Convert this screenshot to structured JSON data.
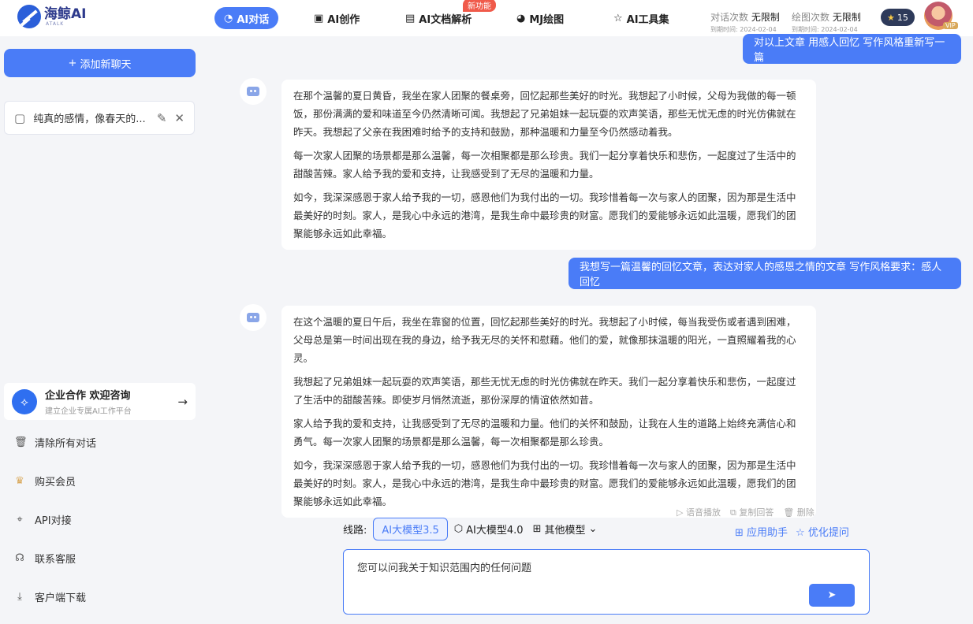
{
  "brand": {
    "name": "海鲸AI",
    "sub": "ATALK"
  },
  "nav": [
    {
      "label": "AI对话",
      "icon": "chat-icon"
    },
    {
      "label": "AI创作",
      "icon": "create-icon"
    },
    {
      "label": "AI文档解析",
      "icon": "pdf-icon",
      "badge": "新功能"
    },
    {
      "label": "MJ绘图",
      "icon": "palette-icon"
    },
    {
      "label": "AI工具集",
      "icon": "star-icon"
    }
  ],
  "quota": {
    "chat_label": "对话次数",
    "chat_value": "无限制",
    "chat_expire": "到期时间: 2024-02-04",
    "draw_label": "绘图次数",
    "draw_value": "无限制",
    "draw_expire": "到期时间: 2024-02-04"
  },
  "user": {
    "points": "15",
    "vip": "VIP"
  },
  "sidebar": {
    "new_chat": "添加新聊天",
    "chat_item": "纯真的感情，像春天的...",
    "enterprise": {
      "title": "企业合作 欢迎咨询",
      "sub": "建立企业专属AI工作平台"
    },
    "links": [
      "清除所有对话",
      "购买会员",
      "API对接",
      "联系客服",
      "客户端下载"
    ]
  },
  "messages": {
    "user1": "对以上文章 用感人回忆 写作风格重新写一篇",
    "bot1": [
      "在那个温馨的夏日黄昏，我坐在家人团聚的餐桌旁，回忆起那些美好的时光。我想起了小时候，父母为我做的每一顿饭，那份满满的爱和味道至今仍然清晰可闻。我想起了兄弟姐妹一起玩耍的欢声笑语，那些无忧无虑的时光仿佛就在昨天。我想起了父亲在我困难时给予的支持和鼓励，那种温暖和力量至今仍然感动着我。",
      "每一次家人团聚的场景都是那么温馨，每一次相聚都是那么珍贵。我们一起分享着快乐和悲伤，一起度过了生活中的甜酸苦辣。家人给予我的爱和支持，让我感受到了无尽的温暖和力量。",
      "如今，我深深感恩于家人给予我的一切，感恩他们为我付出的一切。我珍惜着每一次与家人的团聚，因为那是生活中最美好的时刻。家人，是我心中永远的港湾，是我生命中最珍贵的财富。愿我们的爱能够永远如此温暖，愿我们的团聚能够永远如此幸福。"
    ],
    "user2": "我想写一篇温馨的回忆文章，表达对家人的感恩之情的文章 写作风格要求：感人回忆",
    "bot2": [
      "在这个温暖的夏日午后，我坐在靠窗的位置，回忆起那些美好的时光。我想起了小时候，每当我受伤或者遇到困难，父母总是第一时间出现在我的身边，给予我无尽的关怀和慰藉。他们的爱，就像那抹温暖的阳光，一直照耀着我的心灵。",
      "我想起了兄弟姐妹一起玩耍的欢声笑语，那些无忧无虑的时光仿佛就在昨天。我们一起分享着快乐和悲伤，一起度过了生活中的甜酸苦辣。即使岁月悄然流逝，那份深厚的情谊依然如昔。",
      "家人给予我的爱和支持，让我感受到了无尽的温暖和力量。他们的关怀和鼓励，让我在人生的道路上始终充满信心和勇气。每一次家人团聚的场景都是那么温馨，每一次相聚都是那么珍贵。",
      "如今，我深深感恩于家人给予我的一切，感恩他们为我付出的一切。我珍惜着每一次与家人的团聚，因为那是生活中最美好的时刻。家人，是我心中永远的港湾，是我生命中最珍贵的财富。愿我们的爱能够永远如此温暖，愿我们的团聚能够永远如此幸福。"
    ],
    "actions": [
      "语音播放",
      "复制回答",
      "删除"
    ]
  },
  "composer": {
    "route_label": "线路:",
    "models": [
      "AI大模型3.5",
      "AI大模型4.0",
      "其他模型"
    ],
    "helpers": [
      "应用助手",
      "优化提问"
    ],
    "placeholder": "您可以问我关于知识范围内的任何问题"
  }
}
